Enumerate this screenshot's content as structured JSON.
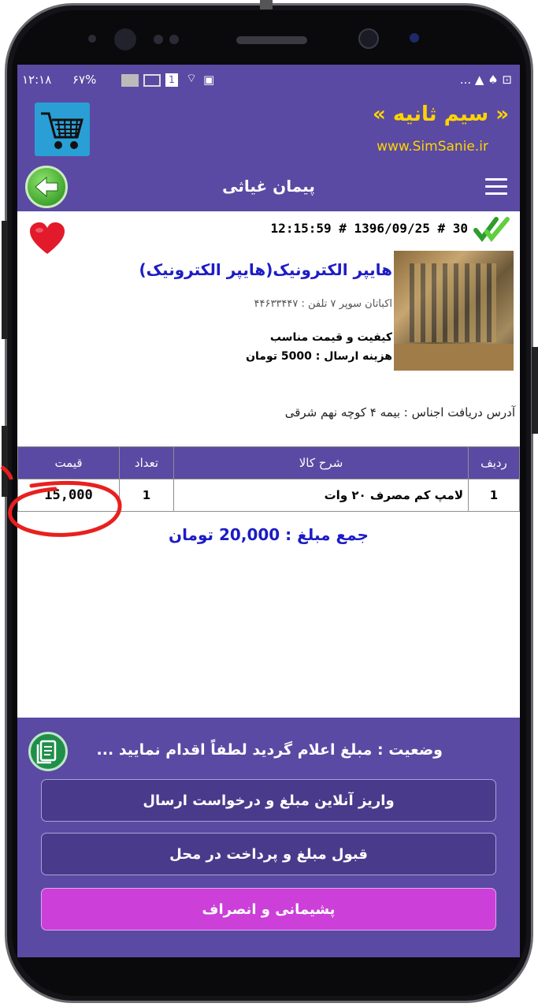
{
  "status_bar": {
    "time": "۱۲:۱۸",
    "battery": "۶۷%",
    "sim": "1",
    "right_icons": "... ▲ ♠ ⊡"
  },
  "header": {
    "brand": "« سیم ثانیه »",
    "url": "www.SimSanie.ir",
    "logo_icon": "shopping-cart-icon",
    "brand_color": "#ffd400",
    "bar_color": "#5a4aa3"
  },
  "titlebar": {
    "title": "پیمان غیاثی",
    "back_icon": "back-arrow-icon",
    "menu_icon": "hamburger-menu-icon"
  },
  "order": {
    "line": "12:15:59 # 1396/09/25 # 30",
    "status_icon": "double-check-icon",
    "favorite_icon": "heart-icon"
  },
  "shop": {
    "name": "هایپر الکترونیک(هایپر الکترونیک)",
    "location": "اکباتان سوپر ۷ تلفن : ۴۴۶۳۳۴۴۷",
    "quality": "کیفیت و قیمت مناسب",
    "shipping": "هزینه ارسال : 5000 تومان"
  },
  "address": "آدرس دریافت اجناس : بیمه ۴ کوچه نهم شرقی",
  "table": {
    "headers": {
      "row": "ردیف",
      "desc": "شرح کالا",
      "qty": "تعداد",
      "price": "قیمت"
    },
    "rows": [
      {
        "row": "1",
        "desc": "لامپ کم مصرف ۲۰ وات",
        "qty": "1",
        "price": "15,000"
      }
    ]
  },
  "total": "جمع مبلغ : 20,000 تومان",
  "bottom": {
    "status": "وضعیت : مبلغ اعلام گردید لطفاً اقدام نمایید ...",
    "status_icon": "document-icon",
    "btn_online": "واریز آنلاین مبلغ و درخواست ارسال",
    "btn_accept": "قبول مبلغ و پرداخت در محل",
    "btn_cancel": "پشیمانی و انصراف",
    "cancel_color": "#cc3fd8"
  }
}
